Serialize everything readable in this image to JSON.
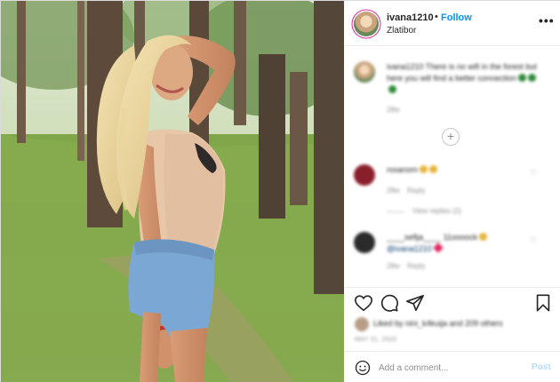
{
  "post": {
    "username": "ivana1210",
    "separator": "•",
    "follow_label": "Follow",
    "location": "Zlatibor",
    "more_icon": "more-dots-icon",
    "more_glyph": "•••"
  },
  "comments": {
    "caption": {
      "text": "ivana1210 There is no wifi in the forest but here you will find a better connection",
      "age": "28w"
    },
    "load_more_glyph": "+",
    "items": [
      {
        "user": "rosanom",
        "meta_age": "28w",
        "meta_reply": "Reply",
        "view_replies": "View replies (2)"
      },
      {
        "user": "____sefija____",
        "mention_suffix": "11oooock",
        "text": "@ivana1210",
        "meta_age": "28w",
        "meta_reply": "Reply"
      }
    ]
  },
  "actions": {
    "like_icon": "heart-icon",
    "comment_icon": "comment-bubble-icon",
    "share_icon": "paper-plane-icon",
    "save_icon": "bookmark-icon",
    "likes_text": "Liked by nini_k4kuija and 209 others",
    "date": "MAY 31, 2020"
  },
  "add_comment": {
    "emoji_icon": "smiley-icon",
    "placeholder": "Add a comment...",
    "post_label": "Post"
  },
  "colors": {
    "accent_blue": "#0095f6",
    "post_disabled": "#b2dffc",
    "muted": "#8e8e8e"
  }
}
